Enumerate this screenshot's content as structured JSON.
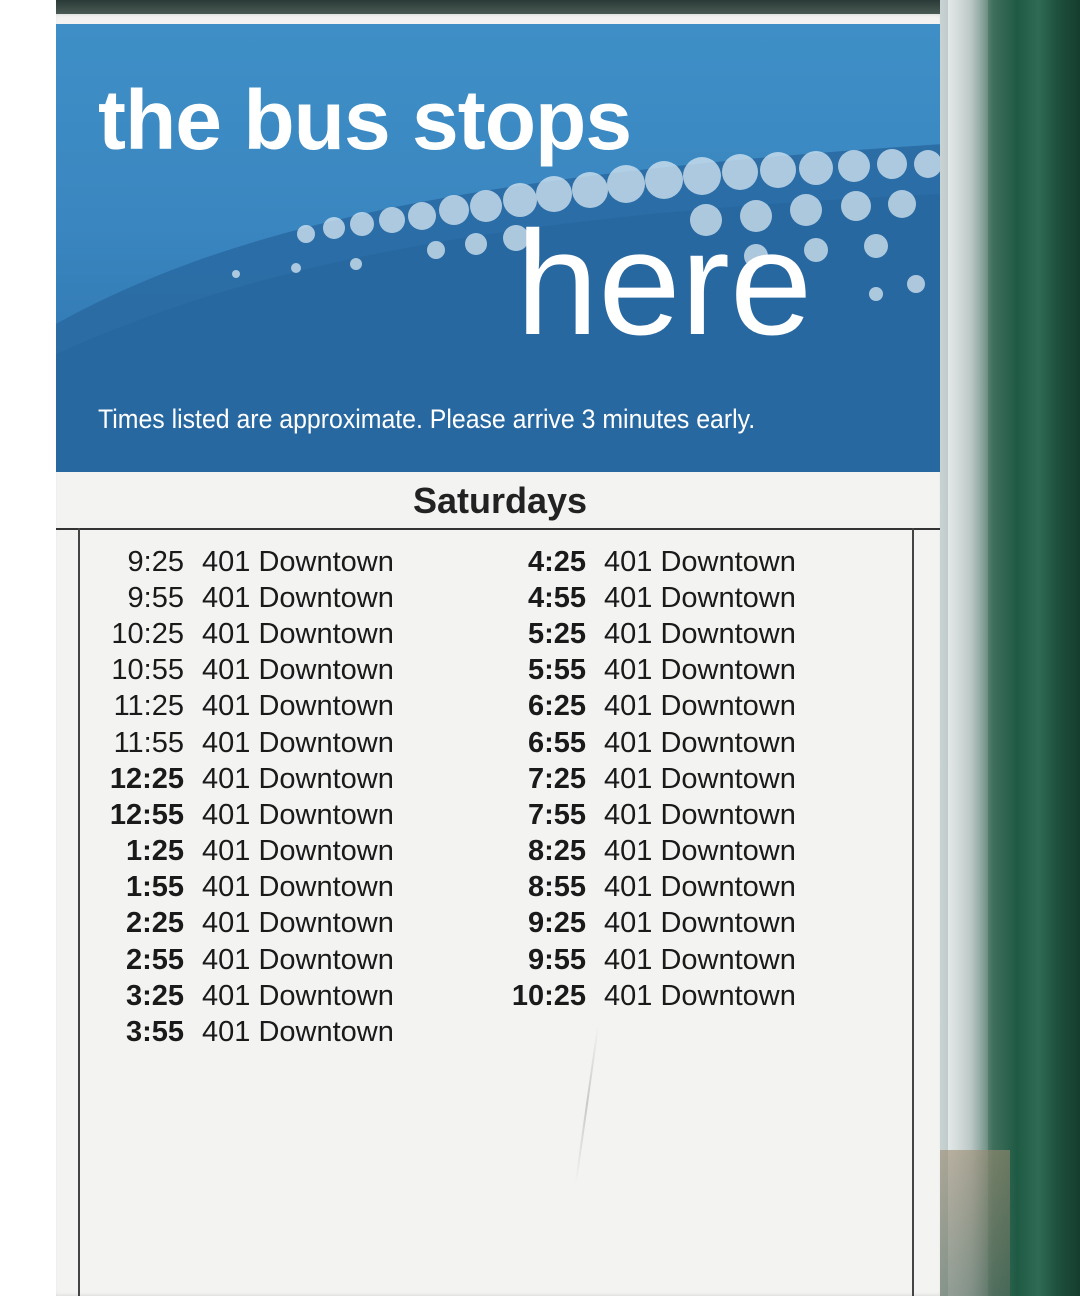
{
  "header": {
    "line1": "the bus stops",
    "line2": "here",
    "notice": "Times listed are approximate. Please arrive 3 minutes early."
  },
  "schedule": {
    "heading": "Saturdays",
    "left_column": [
      {
        "time": "9:25",
        "route": "401 Downtown",
        "pm": false
      },
      {
        "time": "9:55",
        "route": "401 Downtown",
        "pm": false
      },
      {
        "time": "10:25",
        "route": "401 Downtown",
        "pm": false
      },
      {
        "time": "10:55",
        "route": "401 Downtown",
        "pm": false
      },
      {
        "time": "11:25",
        "route": "401 Downtown",
        "pm": false
      },
      {
        "time": "11:55",
        "route": "401 Downtown",
        "pm": false
      },
      {
        "time": "12:25",
        "route": "401 Downtown",
        "pm": true
      },
      {
        "time": "12:55",
        "route": "401 Downtown",
        "pm": true
      },
      {
        "time": "1:25",
        "route": "401 Downtown",
        "pm": true
      },
      {
        "time": "1:55",
        "route": "401 Downtown",
        "pm": true
      },
      {
        "time": "2:25",
        "route": "401 Downtown",
        "pm": true
      },
      {
        "time": "2:55",
        "route": "401 Downtown",
        "pm": true
      },
      {
        "time": "3:25",
        "route": "401 Downtown",
        "pm": true
      },
      {
        "time": "3:55",
        "route": "401 Downtown",
        "pm": true
      }
    ],
    "right_column": [
      {
        "time": "4:25",
        "route": "401 Downtown",
        "pm": true
      },
      {
        "time": "4:55",
        "route": "401 Downtown",
        "pm": true
      },
      {
        "time": "5:25",
        "route": "401 Downtown",
        "pm": true
      },
      {
        "time": "5:55",
        "route": "401 Downtown",
        "pm": true
      },
      {
        "time": "6:25",
        "route": "401 Downtown",
        "pm": true
      },
      {
        "time": "6:55",
        "route": "401 Downtown",
        "pm": true
      },
      {
        "time": "7:25",
        "route": "401 Downtown",
        "pm": true
      },
      {
        "time": "7:55",
        "route": "401 Downtown",
        "pm": true
      },
      {
        "time": "8:25",
        "route": "401 Downtown",
        "pm": true
      },
      {
        "time": "8:55",
        "route": "401 Downtown",
        "pm": true
      },
      {
        "time": "9:25",
        "route": "401 Downtown",
        "pm": true
      },
      {
        "time": "9:55",
        "route": "401 Downtown",
        "pm": true
      },
      {
        "time": "10:25",
        "route": "401 Downtown",
        "pm": true
      }
    ]
  },
  "colors": {
    "banner_blue": "#3a86c0",
    "frame_green": "#1f5a44",
    "poster_background": "#f3f4f2"
  }
}
